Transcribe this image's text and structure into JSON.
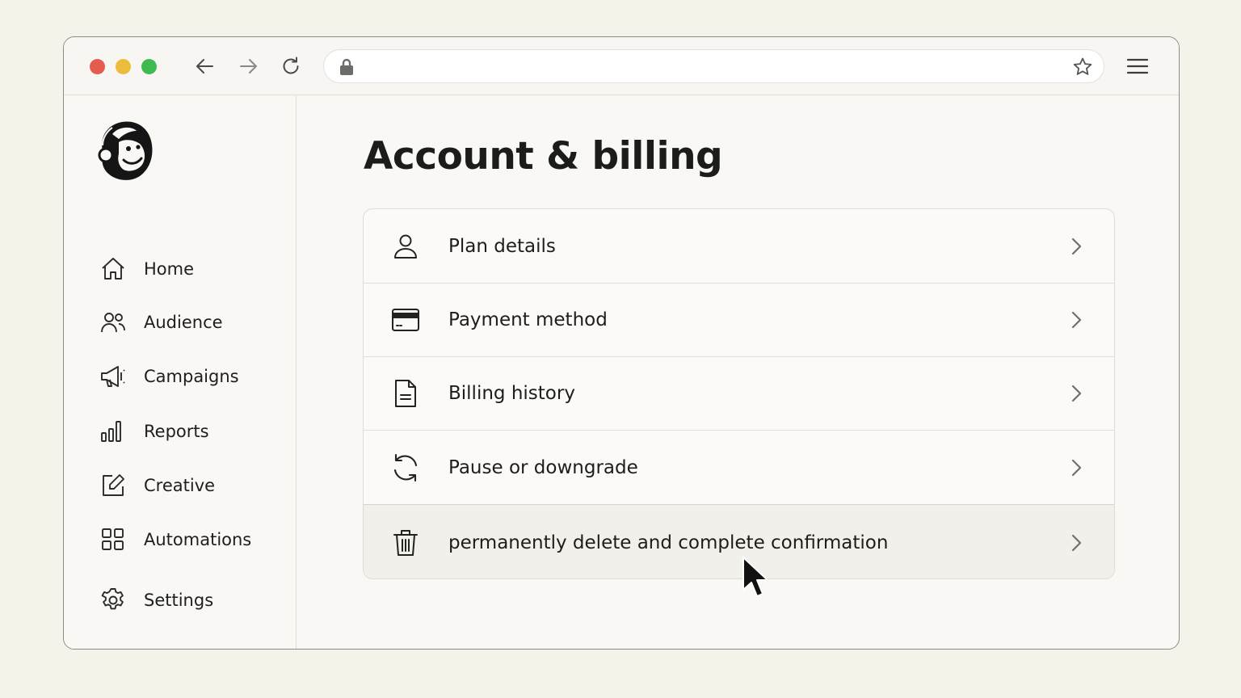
{
  "browser": {
    "url_value": "",
    "icons": {
      "back": "arrow-left-icon",
      "forward": "arrow-right-icon",
      "reload": "reload-icon",
      "lock": "lock-icon",
      "bookmark": "star-icon",
      "menu": "hamburger-menu-icon"
    },
    "traffic_lights": [
      "#e45b4f",
      "#ecbc3c",
      "#3fba4e"
    ]
  },
  "sidebar": {
    "logo": "mailchimp-freddie-logo",
    "items": [
      {
        "label": "Home",
        "icon": "home-icon"
      },
      {
        "label": "Audience",
        "icon": "users-icon"
      },
      {
        "label": "Campaigns",
        "icon": "megaphone-icon"
      },
      {
        "label": "Reports",
        "icon": "bar-chart-icon"
      },
      {
        "label": "Creative",
        "icon": "edit-icon"
      },
      {
        "label": "Automations",
        "icon": "grid-icon"
      },
      {
        "label": "Settings",
        "icon": "gear-icon"
      }
    ]
  },
  "main": {
    "title": "Account & billing",
    "rows": [
      {
        "label": "Plan details",
        "icon": "user-icon"
      },
      {
        "label": "Payment method",
        "icon": "credit-card-icon"
      },
      {
        "label": "Billing history",
        "icon": "document-icon"
      },
      {
        "label": "Pause or downgrade",
        "icon": "refresh-icon"
      },
      {
        "label": "permanently delete and complete confirmation",
        "icon": "trash-icon",
        "highlighted": true
      }
    ]
  },
  "colors": {
    "page_background": "#f5f2ea",
    "window_background": "#f9f8f5",
    "text": "#1d1d1b",
    "highlight_row": "#f2f0ea"
  }
}
